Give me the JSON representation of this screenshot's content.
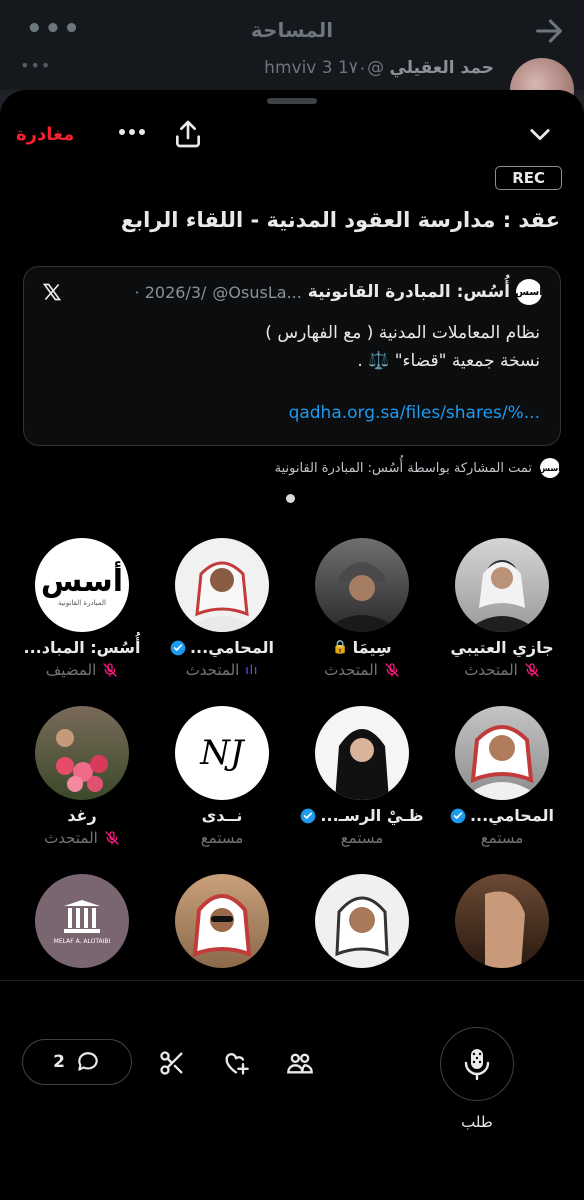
{
  "background": {
    "title": "المساحة",
    "tweet_author": "حمد العقيلي",
    "tweet_handle": "@hmviv",
    "tweet_age": "3 1٧٠",
    "more_label": "•••"
  },
  "sheet": {
    "leave_label": "مغادرة",
    "more_label": "•••",
    "rec_label": "REC",
    "title": "عقد : مدارسة العقود المدنية - اللقاء الرابع"
  },
  "pinned_post": {
    "author": "أُسُس: المبادرة القانونية",
    "handle": "@OsusLa...",
    "date": "· 2026/3/",
    "logo_text": "أسس",
    "line1": "نظام المعاملات المدنية ( مع الفهارس )",
    "line2": "نسخة جمعية \"قضاء\" ⚖️ .",
    "link": "qadha.org.sa/files/shares/%..."
  },
  "shared_by": {
    "text": "تمت المشاركة بواسطة أُسُس: المبادرة القانونية",
    "logo_text": "أسس"
  },
  "participants": [
    {
      "name": "جازي العتيبي",
      "role": "المتحدث",
      "verified": false,
      "mic_muted": true,
      "lock": false,
      "speaking": false
    },
    {
      "name": "سِيمَا",
      "role": "المتحدث",
      "verified": false,
      "mic_muted": true,
      "lock": true,
      "speaking": false
    },
    {
      "name": "المحامي...",
      "role": "المتحدث",
      "verified": true,
      "mic_muted": false,
      "lock": false,
      "speaking": true
    },
    {
      "name": "أُسُس: المباد...",
      "role": "المضيف",
      "verified": false,
      "mic_muted": true,
      "lock": false,
      "speaking": false
    },
    {
      "name": "المحامي...",
      "role": "مستمع",
      "verified": true,
      "mic_muted": false,
      "lock": false,
      "speaking": false
    },
    {
      "name": "ظـيْ الرسـ...",
      "role": "مستمع",
      "verified": true,
      "mic_muted": false,
      "lock": false,
      "speaking": false
    },
    {
      "name": "نــدى",
      "role": "مستمع",
      "verified": false,
      "mic_muted": false,
      "lock": false,
      "speaking": false
    },
    {
      "name": "رغد",
      "role": "المتحدث",
      "verified": false,
      "mic_muted": true,
      "lock": false,
      "speaking": false
    }
  ],
  "avatar_texts": {
    "osus": "أسس",
    "osus_sub": "المبادرة القانونية",
    "nada": "NJ",
    "brand_card": "MELAF A. ALOTAIBI"
  },
  "bottom_bar": {
    "comments_count": "2",
    "mic_label": "طلب"
  },
  "colors": {
    "accent_blue": "#1d9bf0",
    "leave_red": "#f4212e",
    "mic_muted_pink": "#f91880",
    "speaking_purple": "#7856ff"
  }
}
